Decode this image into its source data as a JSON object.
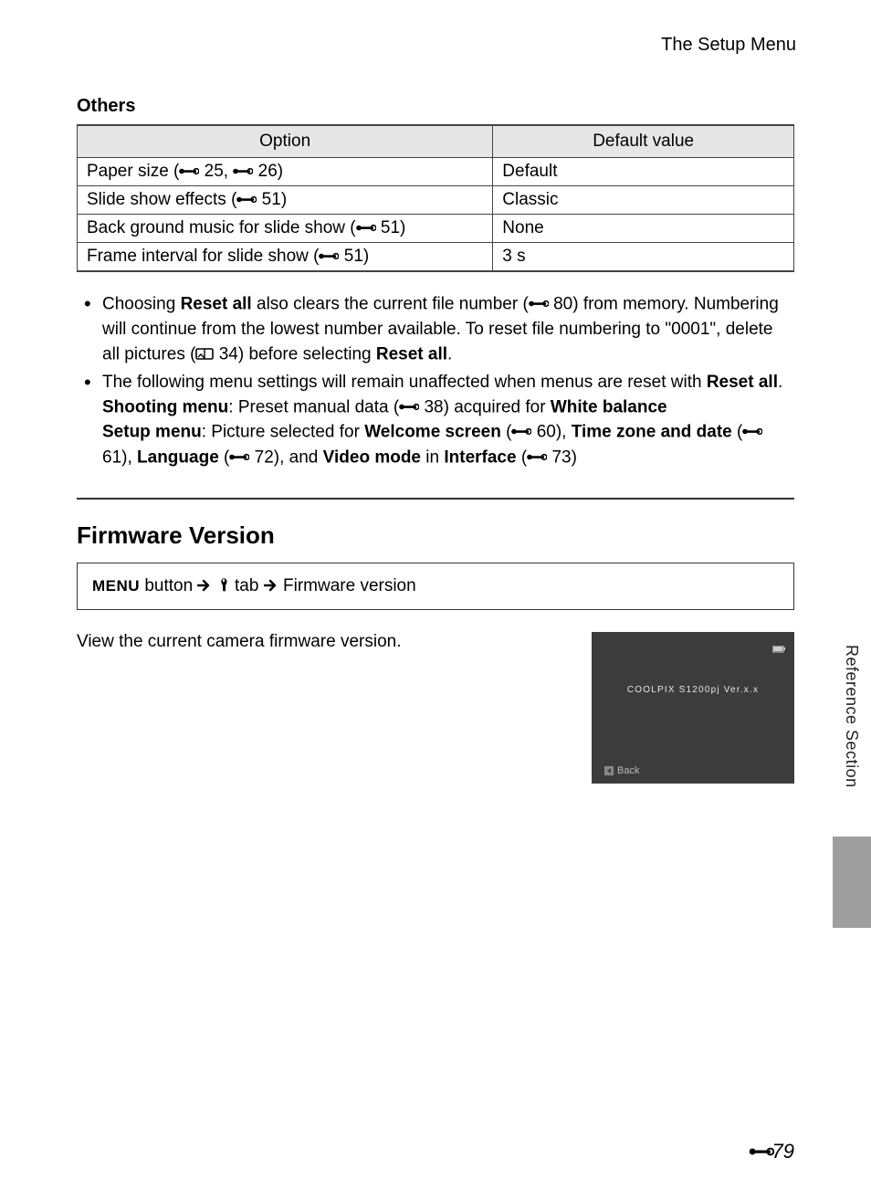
{
  "header": {
    "title": "The Setup Menu"
  },
  "section_others": "Others",
  "table": {
    "head": {
      "option": "Option",
      "default": "Default value"
    },
    "rows": [
      {
        "label_pre": "Paper size (",
        "ref1": " 25, ",
        "ref2": " 26)",
        "default": "Default"
      },
      {
        "label_pre": "Slide show effects (",
        "ref1": " 51)",
        "default": "Classic"
      },
      {
        "label_pre": "Back ground music for slide show (",
        "ref1": " 51)",
        "default": "None"
      },
      {
        "label_pre": "Frame interval for slide show (",
        "ref1": " 51)",
        "default": "3 s"
      }
    ]
  },
  "bullet1": {
    "t0": "Choosing ",
    "reset_all": "Reset all",
    "t1": " also clears the current file number (",
    "ref80": " 80) from memory. Numbering will continue from the lowest number available. To reset file numbering to \"0001\", delete all pictures (",
    "book34": " 34) before selecting ",
    "t2": "."
  },
  "bullet2": {
    "t0": "The following menu settings will remain unaffected when menus are reset with ",
    "reset_all": "Reset all",
    "t1": ".",
    "shooting": "Shooting menu",
    "t2": ": Preset manual data (",
    "ref38": " 38) acquired for ",
    "wb": "White balance",
    "setup": "Setup menu",
    "t3": ": Picture selected for ",
    "welcome": "Welcome screen",
    "t4": " (",
    "ref60": " 60), ",
    "tzd": "Time zone and date",
    "t5": " (",
    "ref61": " 61), ",
    "lang": "Language",
    "t6": " (",
    "ref72": " 72), and ",
    "video": "Video mode",
    "t7": " in ",
    "iface": "Interface",
    "t8": " (",
    "ref73": " 73)"
  },
  "firmware": {
    "heading": "Firmware Version",
    "nav": {
      "menu": "MENU",
      "button_text": " button ",
      "tab_text": " tab ",
      "fw_text": " Firmware version"
    },
    "body": "View the current camera firmware version.",
    "screen": {
      "text": "COOLPIX S1200pj Ver.x.x",
      "back": "Back"
    }
  },
  "side_tab": "Reference Section",
  "page_number": "79"
}
